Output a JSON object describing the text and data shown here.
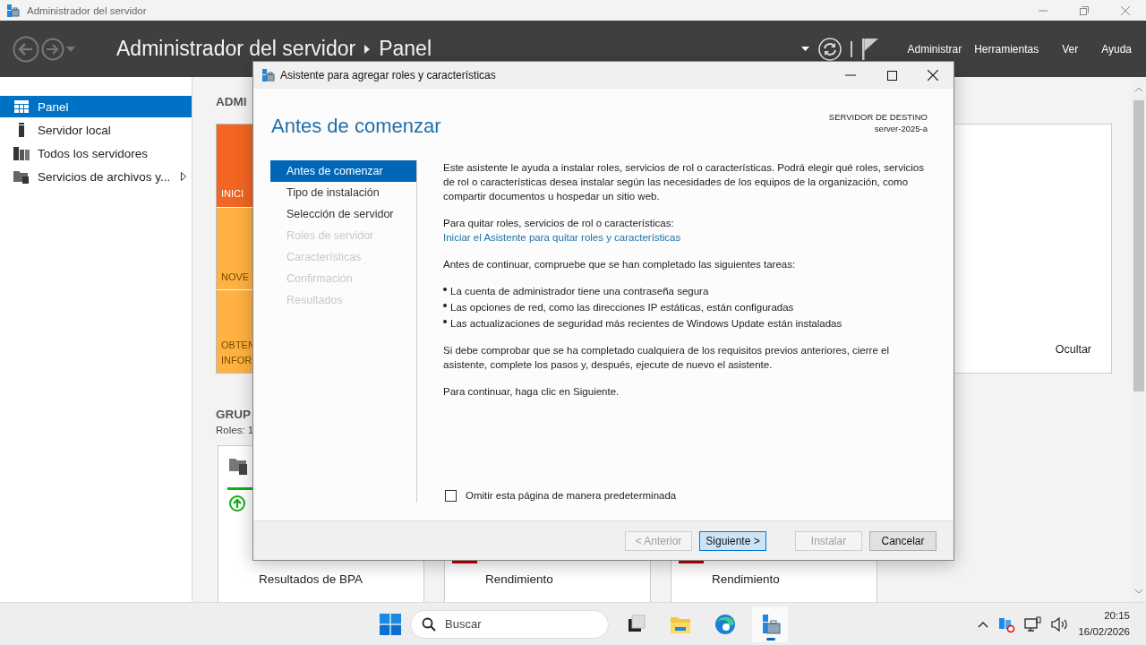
{
  "window": {
    "title": "Administrador del servidor"
  },
  "header": {
    "breadcrumb": [
      "Administrador del servidor",
      "Panel"
    ],
    "menus": [
      "Administrar",
      "Herramientas",
      "Ver",
      "Ayuda"
    ]
  },
  "sidebar": {
    "items": [
      {
        "label": "Panel",
        "selected": true,
        "expandable": false
      },
      {
        "label": "Servidor local",
        "selected": false,
        "expandable": false
      },
      {
        "label": "Todos los servidores",
        "selected": false,
        "expandable": false
      },
      {
        "label": "Servicios de archivos y...",
        "selected": false,
        "expandable": true
      }
    ]
  },
  "content": {
    "heading": "ADMI",
    "tiles": [
      {
        "label": "INICI",
        "color": "#f26522"
      },
      {
        "label": "NOVE",
        "color": "#ffb142"
      },
      {
        "label": "OBTEN\nINFOR",
        "color": "#ffb142"
      }
    ],
    "hide_link": "Ocultar",
    "groups_heading": "GRUP",
    "roles": "Roles: 1",
    "cards": [
      {
        "title": "Resultados de BPA",
        "kind": "ok"
      },
      {
        "title": "Rendimiento",
        "kind": "alert"
      },
      {
        "title": "Rendimiento",
        "kind": "alert"
      }
    ]
  },
  "dialog": {
    "title": "Asistente para agregar roles y características",
    "heading": "Antes de comenzar",
    "destination": {
      "label": "SERVIDOR DE DESTINO",
      "server": "server-2025-a"
    },
    "steps": [
      {
        "label": "Antes de comenzar",
        "selected": true,
        "disabled": false
      },
      {
        "label": "Tipo de instalación",
        "selected": false,
        "disabled": false
      },
      {
        "label": "Selección de servidor",
        "selected": false,
        "disabled": false
      },
      {
        "label": "Roles de servidor",
        "selected": false,
        "disabled": true
      },
      {
        "label": "Características",
        "selected": false,
        "disabled": true
      },
      {
        "label": "Confirmación",
        "selected": false,
        "disabled": true
      },
      {
        "label": "Resultados",
        "selected": false,
        "disabled": true
      }
    ],
    "intro": "Este asistente le ayuda a instalar roles, servicios de rol o características. Podrá elegir qué roles, servicios de rol o características desea instalar según las necesidades de los equipos de la organización, como compartir documentos u hospedar un sitio web.",
    "remove_label": "Para quitar roles, servicios de rol o características:",
    "remove_link": "Iniciar el Asistente para quitar roles y características",
    "tasks_label": "Antes de continuar, compruebe que se han completado las siguientes tareas:",
    "bullets": [
      "La cuenta de administrador tiene una contraseña segura",
      "Las opciones de red, como las direcciones IP estáticas, están configuradas",
      "Las actualizaciones de seguridad más recientes de Windows Update están instaladas"
    ],
    "check_note": "Si debe comprobar que se ha completado cualquiera de los requisitos previos anteriores, cierre el asistente, complete los pasos y, después, ejecute de nuevo el asistente.",
    "continue_note": "Para continuar, haga clic en Siguiente.",
    "checkbox": {
      "label": "Omitir esta página de manera predeterminada",
      "checked": false
    },
    "buttons": [
      {
        "label": "< Anterior",
        "disabled": true,
        "focused": false
      },
      {
        "label": "Siguiente >",
        "disabled": false,
        "focused": true
      },
      {
        "label": "Instalar",
        "disabled": true,
        "focused": false
      },
      {
        "label": "Cancelar",
        "disabled": false,
        "focused": false
      }
    ]
  },
  "taskbar": {
    "search": {
      "placeholder": "Buscar"
    },
    "apps": [
      {
        "kind": "taskview",
        "active": false
      },
      {
        "kind": "explorer",
        "active": false
      },
      {
        "kind": "edge",
        "active": false
      },
      {
        "kind": "servermanager",
        "active": true
      }
    ],
    "time": "20:15",
    "date": "16/02/2026"
  }
}
